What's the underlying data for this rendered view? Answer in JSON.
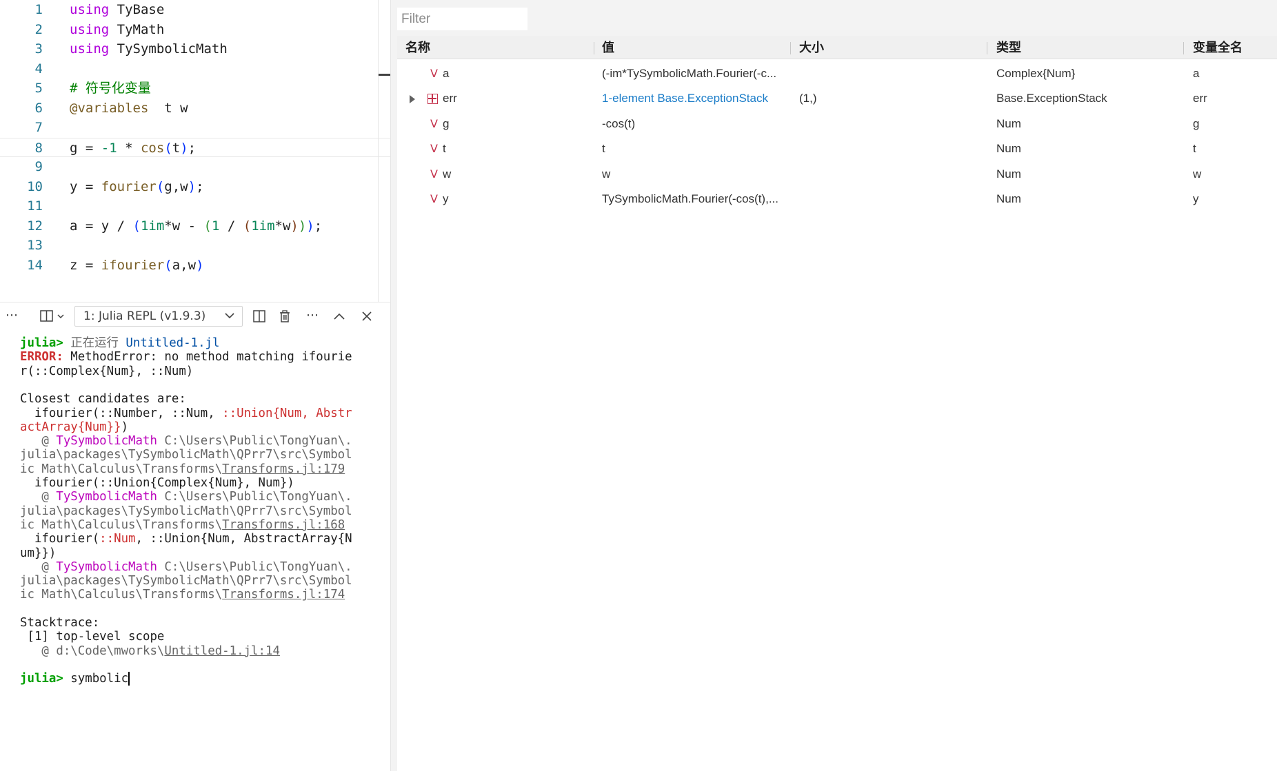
{
  "editor": {
    "lines": [
      {
        "n": "1",
        "tokens": [
          {
            "t": "using",
            "c": "kw"
          },
          {
            "t": " TyBase",
            "c": ""
          }
        ]
      },
      {
        "n": "2",
        "tokens": [
          {
            "t": "using",
            "c": "kw"
          },
          {
            "t": " TyMath",
            "c": ""
          }
        ]
      },
      {
        "n": "3",
        "tokens": [
          {
            "t": "using",
            "c": "kw"
          },
          {
            "t": " TySymbolicMath",
            "c": ""
          }
        ]
      },
      {
        "n": "4",
        "tokens": []
      },
      {
        "n": "5",
        "tokens": [
          {
            "t": "# 符号化变量",
            "c": "cm"
          }
        ]
      },
      {
        "n": "6",
        "tokens": [
          {
            "t": "@variables",
            "c": "mac"
          },
          {
            "t": "  t w",
            "c": ""
          }
        ]
      },
      {
        "n": "7",
        "tokens": []
      },
      {
        "n": "8",
        "tokens": [
          {
            "t": "g = ",
            "c": ""
          },
          {
            "t": "-1",
            "c": "num"
          },
          {
            "t": " * ",
            "c": ""
          },
          {
            "t": "cos",
            "c": "fn"
          },
          {
            "t": "(",
            "c": "p1"
          },
          {
            "t": "t",
            "c": ""
          },
          {
            "t": ")",
            "c": "p1"
          },
          {
            "t": ";",
            "c": ""
          }
        ]
      },
      {
        "n": "9",
        "tokens": []
      },
      {
        "n": "10",
        "tokens": [
          {
            "t": "y = ",
            "c": ""
          },
          {
            "t": "fourier",
            "c": "fn"
          },
          {
            "t": "(",
            "c": "p1"
          },
          {
            "t": "g,w",
            "c": ""
          },
          {
            "t": ")",
            "c": "p1"
          },
          {
            "t": ";",
            "c": ""
          }
        ]
      },
      {
        "n": "11",
        "tokens": []
      },
      {
        "n": "12",
        "tokens": [
          {
            "t": "a = y / ",
            "c": ""
          },
          {
            "t": "(",
            "c": "p1"
          },
          {
            "t": "1im",
            "c": "num"
          },
          {
            "t": "*w - ",
            "c": ""
          },
          {
            "t": "(",
            "c": "p2"
          },
          {
            "t": "1",
            "c": "num"
          },
          {
            "t": " / ",
            "c": ""
          },
          {
            "t": "(",
            "c": "p3"
          },
          {
            "t": "1im",
            "c": "num"
          },
          {
            "t": "*w",
            "c": ""
          },
          {
            "t": ")",
            "c": "p3"
          },
          {
            "t": ")",
            "c": "p2"
          },
          {
            "t": ")",
            "c": "p1"
          },
          {
            "t": ";",
            "c": ""
          }
        ]
      },
      {
        "n": "13",
        "tokens": []
      },
      {
        "n": "14",
        "tokens": [
          {
            "t": "z = ",
            "c": ""
          },
          {
            "t": "ifourier",
            "c": "fn"
          },
          {
            "t": "(",
            "c": "p1"
          },
          {
            "t": "a,w",
            "c": ""
          },
          {
            "t": ")",
            "c": "p1"
          }
        ]
      }
    ]
  },
  "terminal_toolbar": {
    "more_left": "···",
    "selected_terminal": "1: Julia REPL (v1.9.3)",
    "more_right": "···"
  },
  "terminal": {
    "lines": [
      [
        {
          "t": "julia>",
          "c": "prompt"
        },
        {
          "t": " ",
          "c": ""
        },
        {
          "t": "正在运行",
          "c": "zh"
        },
        {
          "t": " ",
          "c": ""
        },
        {
          "t": "Untitled-1.jl",
          "c": "run-file"
        }
      ],
      [
        {
          "t": "ERROR:",
          "c": "err"
        },
        {
          "t": " MethodError: no method matching ifourie",
          "c": ""
        }
      ],
      [
        {
          "t": "r(::Complex{Num}, ::Num)",
          "c": ""
        }
      ],
      [],
      [
        {
          "t": "Closest candidates are:",
          "c": ""
        }
      ],
      [
        {
          "t": "  ifourier(::Number, ::Num, ",
          "c": ""
        },
        {
          "t": "::Union{Num, Abstr",
          "c": "red"
        }
      ],
      [
        {
          "t": "actArray{Num}}",
          "c": "red"
        },
        {
          "t": ")",
          "c": ""
        }
      ],
      [
        {
          "t": "   @ ",
          "c": "path"
        },
        {
          "t": "TySymbolicMath",
          "c": "mod"
        },
        {
          "t": " C:\\Users\\Public\\TongYuan\\.",
          "c": "path"
        }
      ],
      [
        {
          "t": "julia\\packages\\TySymbolicMath\\QPrr7\\src\\Symbol",
          "c": "path"
        }
      ],
      [
        {
          "t": "ic Math\\Calculus\\Transforms\\",
          "c": "path"
        },
        {
          "t": "Transforms.jl:179",
          "c": "link"
        }
      ],
      [
        {
          "t": "  ifourier(::Union{Complex{Num}, Num})",
          "c": ""
        }
      ],
      [
        {
          "t": "   @ ",
          "c": "path"
        },
        {
          "t": "TySymbolicMath",
          "c": "mod"
        },
        {
          "t": " C:\\Users\\Public\\TongYuan\\.",
          "c": "path"
        }
      ],
      [
        {
          "t": "julia\\packages\\TySymbolicMath\\QPrr7\\src\\Symbol",
          "c": "path"
        }
      ],
      [
        {
          "t": "ic Math\\Calculus\\Transforms\\",
          "c": "path"
        },
        {
          "t": "Transforms.jl:168",
          "c": "link"
        }
      ],
      [
        {
          "t": "  ifourier(",
          "c": ""
        },
        {
          "t": "::Num",
          "c": "red"
        },
        {
          "t": ", ::Union{Num, AbstractArray{N",
          "c": ""
        }
      ],
      [
        {
          "t": "um}})",
          "c": ""
        }
      ],
      [
        {
          "t": "   @ ",
          "c": "path"
        },
        {
          "t": "TySymbolicMath",
          "c": "mod"
        },
        {
          "t": " C:\\Users\\Public\\TongYuan\\.",
          "c": "path"
        }
      ],
      [
        {
          "t": "julia\\packages\\TySymbolicMath\\QPrr7\\src\\Symbol",
          "c": "path"
        }
      ],
      [
        {
          "t": "ic Math\\Calculus\\Transforms\\",
          "c": "path"
        },
        {
          "t": "Transforms.jl:174",
          "c": "link"
        }
      ],
      [],
      [
        {
          "t": "Stacktrace:",
          "c": ""
        }
      ],
      [
        {
          "t": " [1] top-level scope",
          "c": ""
        }
      ],
      [
        {
          "t": "   @ d:\\Code\\mworks\\",
          "c": "path"
        },
        {
          "t": "Untitled-1.jl:14",
          "c": "link"
        }
      ],
      [],
      [
        {
          "t": "julia>",
          "c": "prompt"
        },
        {
          "t": " symbolic",
          "c": ""
        },
        {
          "t": "",
          "c": "cursor"
        }
      ]
    ]
  },
  "variables": {
    "filter_placeholder": "Filter",
    "columns": {
      "name": "名称",
      "value": "值",
      "size": "大小",
      "type": "类型",
      "fullname": "变量全名"
    },
    "rows": [
      {
        "icon": "V",
        "name": "a",
        "value": "(-im*TySymbolicMath.Fourier(-c...",
        "size": "",
        "type": "Complex{Num}",
        "fullname": "a",
        "expandable": false
      },
      {
        "icon": "grid",
        "name": "err",
        "value": "1-element Base.ExceptionStack",
        "size": "(1,)",
        "type": "Base.ExceptionStack",
        "fullname": "err",
        "expandable": true
      },
      {
        "icon": "V",
        "name": "g",
        "value": "-cos(t)",
        "size": "",
        "type": "Num",
        "fullname": "g",
        "expandable": false
      },
      {
        "icon": "V",
        "name": "t",
        "value": "t",
        "size": "",
        "type": "Num",
        "fullname": "t",
        "expandable": false
      },
      {
        "icon": "V",
        "name": "w",
        "value": "w",
        "size": "",
        "type": "Num",
        "fullname": "w",
        "expandable": false
      },
      {
        "icon": "V",
        "name": "y",
        "value": "TySymbolicMath.Fourier(-cos(t),...",
        "size": "",
        "type": "Num",
        "fullname": "y",
        "expandable": false
      }
    ]
  }
}
